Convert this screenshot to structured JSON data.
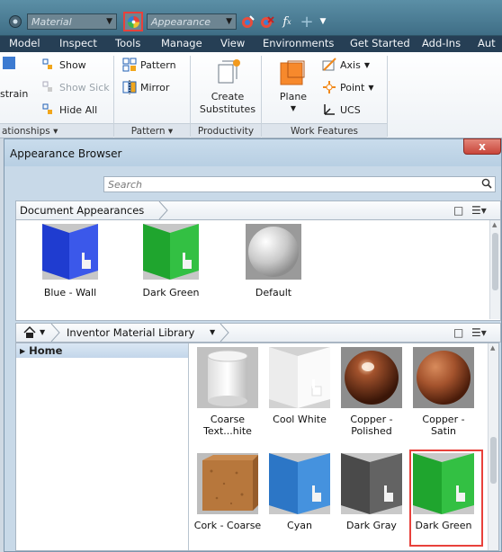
{
  "qat": {
    "material_combo": "Material",
    "appearance_combo": "Appearance",
    "fx_label": "f",
    "fx_sub": "x"
  },
  "tabs": [
    "Model",
    "Inspect",
    "Tools",
    "Manage",
    "View",
    "Environments",
    "Get Started",
    "Add-Ins",
    "Aut"
  ],
  "ribbon": {
    "constrain_fragment": "strain",
    "show": "Show",
    "show_sick": "Show Sick",
    "hide_all": "Hide All",
    "pattern": "Pattern",
    "mirror": "Mirror",
    "create_substitutes_1": "Create",
    "create_substitutes_2": "Substitutes",
    "plane": "Plane",
    "axis": "Axis",
    "point": "Point",
    "ucs": "UCS",
    "panels": [
      "ationships ▾",
      "Pattern ▾",
      "Productivity",
      "Work Features"
    ]
  },
  "window": {
    "title": "Appearance Browser",
    "close_label": "x",
    "search_placeholder": "Search",
    "doc_crumb": "Document Appearances",
    "lib_crumb": "Inventor Material Library",
    "tree_home": "Home"
  },
  "doc_appearances": [
    {
      "label": "Blue - Wall",
      "color": "#2a46e0"
    },
    {
      "label": "Dark Green",
      "color": "#29b338"
    },
    {
      "label": "Default",
      "color": "#d8d8d8"
    }
  ],
  "library": [
    {
      "label": "Coarse Text...hite",
      "color": "#f2f2f2"
    },
    {
      "label": "Cool White",
      "color": "#f7f7f7"
    },
    {
      "label": "Copper - Polished",
      "color": "#7a3820"
    },
    {
      "label": "Copper - Satin",
      "color": "#a4532d"
    },
    {
      "label": "Cork - Coarse",
      "color": "#b7773c"
    },
    {
      "label": "Cyan",
      "color": "#2f84d6"
    },
    {
      "label": "Dark Gray",
      "color": "#5a5a5a"
    },
    {
      "label": "Dark Green",
      "color": "#29b338"
    }
  ],
  "colors": {
    "highlight": "#e8413b",
    "tab_bar": "#263f55"
  }
}
